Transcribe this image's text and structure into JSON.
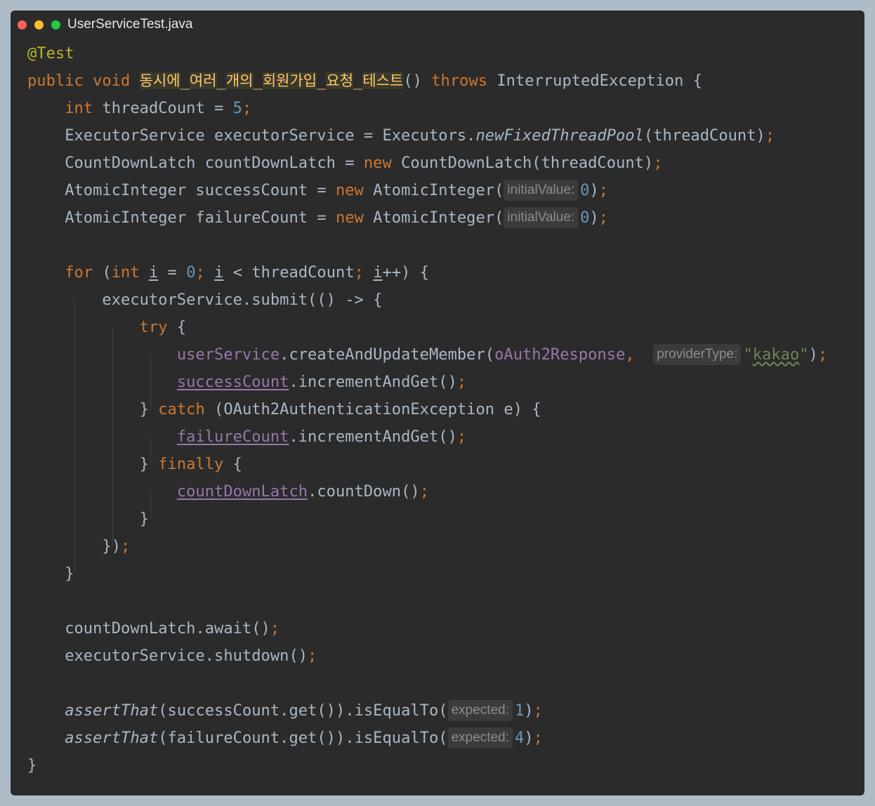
{
  "window": {
    "filename": "UserServiceTest.java"
  },
  "code": {
    "annotation": "@Test",
    "method_name_parts": [
      "동시에",
      "여러",
      "개의",
      "회원가입",
      "요청",
      "테스트"
    ],
    "exception_type": "InterruptedException",
    "thread_count_value": "5",
    "hints": {
      "initial_value": "initialValue:",
      "provider_type": "providerType:",
      "expected": "expected:"
    },
    "provider_string": "kakao",
    "expected_success": "1",
    "expected_failure": "4"
  }
}
